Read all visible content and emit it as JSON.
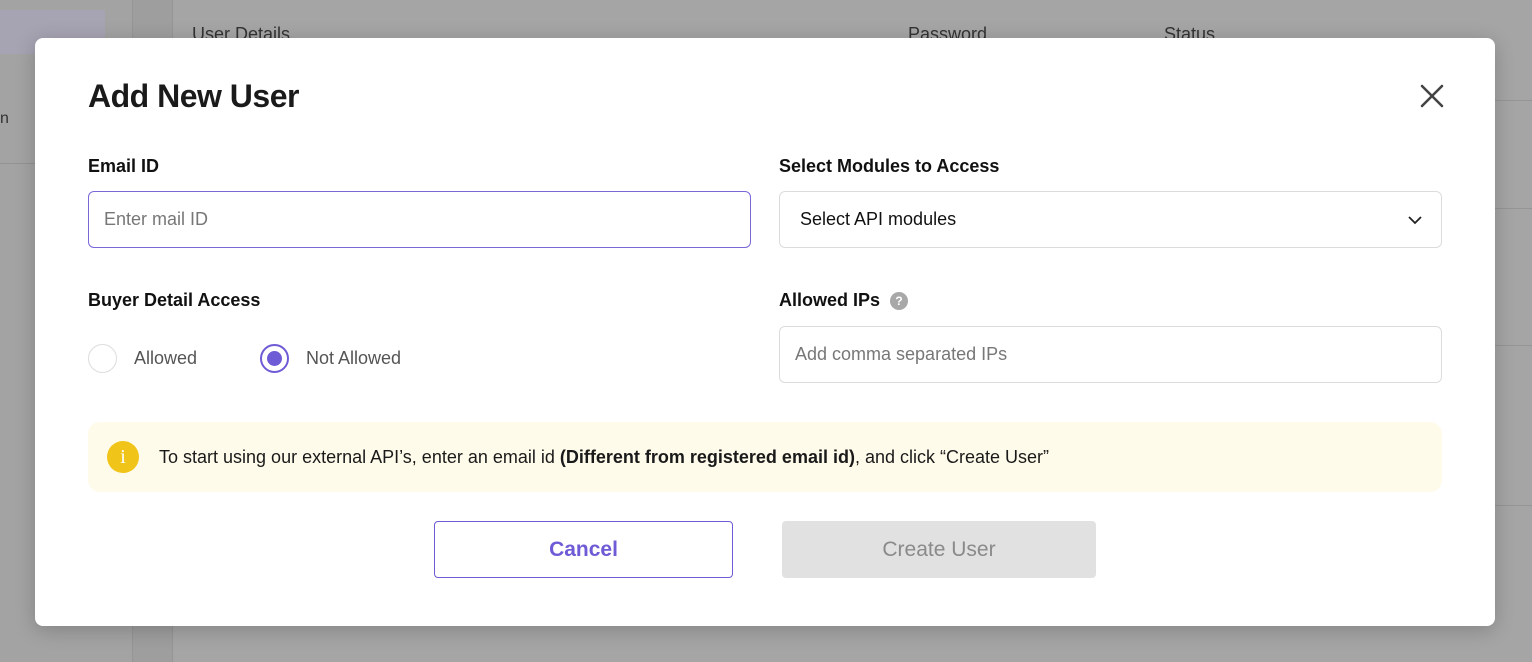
{
  "background": {
    "sidebar_item": "n",
    "table_headers": [
      "User Details",
      "Password",
      "Status"
    ]
  },
  "modal": {
    "title": "Add New User",
    "email": {
      "label": "Email ID",
      "placeholder": "Enter mail ID",
      "value": ""
    },
    "modules": {
      "label": "Select Modules to Access",
      "selected": "Select API modules"
    },
    "buyer_access": {
      "label": "Buyer Detail Access",
      "options": [
        "Allowed",
        "Not Allowed"
      ],
      "selected": "Not Allowed"
    },
    "ips": {
      "label": "Allowed IPs",
      "help": "?",
      "placeholder": "Add comma separated IPs",
      "value": ""
    },
    "info": {
      "icon": "i",
      "text_before": "To start using our external API’s, enter an email id ",
      "text_bold": "(Different from registered email id)",
      "text_after": ", and click “Create User”"
    },
    "cancel_label": "Cancel",
    "create_label": "Create User"
  },
  "colors": {
    "accent": "#6e5bd6",
    "info_bg": "#fffbea",
    "info_icon": "#f0c419"
  }
}
